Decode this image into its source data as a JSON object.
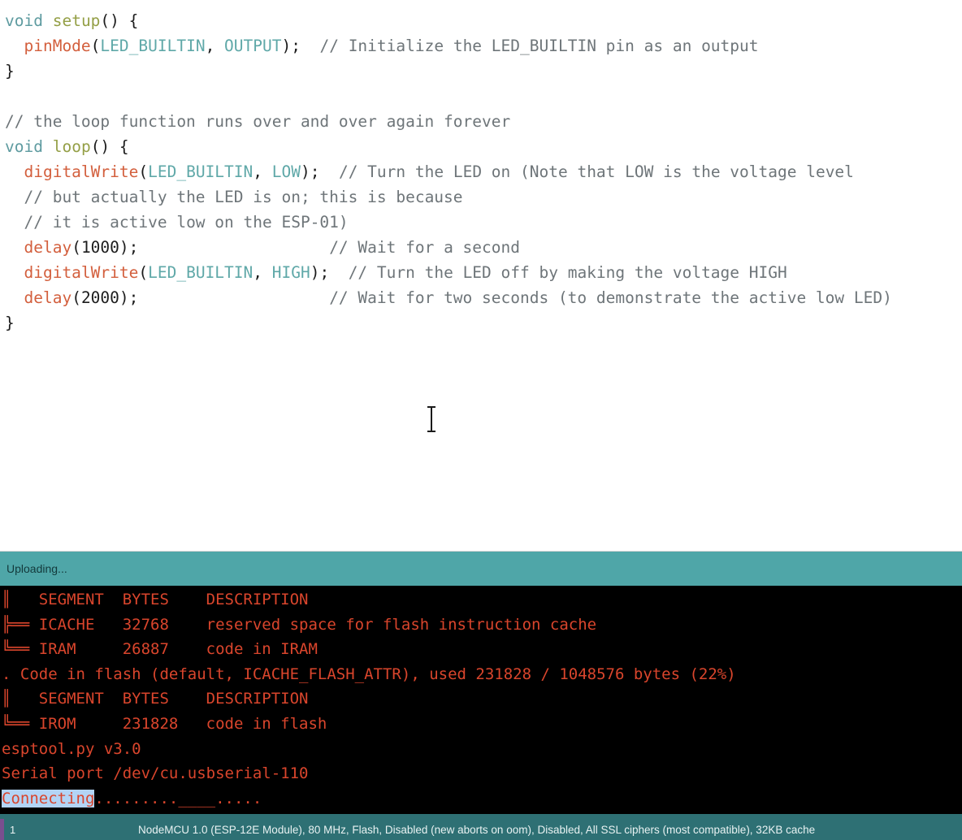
{
  "app": {
    "name": "Arduino IDE",
    "theme_colors": {
      "editor_background": "#ffffff",
      "console_background": "#000000",
      "console_text": "#d9452c",
      "upload_banner": "#4fa6a8",
      "status_bar": "#2e7074",
      "status_accent": "#7a4f8f",
      "selection_highlight": "#b3d4f5",
      "keyword": "#5e9ba0",
      "function_name": "#949f46",
      "builtin_function": "#d35f3d",
      "constant": "#5fa8a8",
      "comment": "#6e7579"
    }
  },
  "editor": {
    "lines": [
      {
        "tokens": [
          {
            "t": "void",
            "c": "kw"
          },
          {
            "t": " ",
            "c": "plain"
          },
          {
            "t": "setup",
            "c": "fnname"
          },
          {
            "t": "() {",
            "c": "plain"
          }
        ]
      },
      {
        "tokens": [
          {
            "t": "  ",
            "c": "plain"
          },
          {
            "t": "pinMode",
            "c": "func"
          },
          {
            "t": "(",
            "c": "plain"
          },
          {
            "t": "LED_BUILTIN",
            "c": "const"
          },
          {
            "t": ", ",
            "c": "plain"
          },
          {
            "t": "OUTPUT",
            "c": "const"
          },
          {
            "t": ");  ",
            "c": "plain"
          },
          {
            "t": "// Initialize the LED_BUILTIN pin as an output",
            "c": "comment"
          }
        ]
      },
      {
        "tokens": [
          {
            "t": "}",
            "c": "plain"
          }
        ]
      },
      {
        "tokens": [
          {
            "t": "",
            "c": "plain"
          }
        ]
      },
      {
        "tokens": [
          {
            "t": "// the loop function runs over and over again forever",
            "c": "comment"
          }
        ]
      },
      {
        "tokens": [
          {
            "t": "void",
            "c": "kw"
          },
          {
            "t": " ",
            "c": "plain"
          },
          {
            "t": "loop",
            "c": "fnname"
          },
          {
            "t": "() {",
            "c": "plain"
          }
        ]
      },
      {
        "tokens": [
          {
            "t": "  ",
            "c": "plain"
          },
          {
            "t": "digitalWrite",
            "c": "func"
          },
          {
            "t": "(",
            "c": "plain"
          },
          {
            "t": "LED_BUILTIN",
            "c": "const"
          },
          {
            "t": ", ",
            "c": "plain"
          },
          {
            "t": "LOW",
            "c": "const"
          },
          {
            "t": ");  ",
            "c": "plain"
          },
          {
            "t": "// Turn the LED on (Note that LOW is the voltage level",
            "c": "comment"
          }
        ]
      },
      {
        "tokens": [
          {
            "t": "  ",
            "c": "plain"
          },
          {
            "t": "// but actually the LED is on; this is because",
            "c": "comment"
          }
        ]
      },
      {
        "tokens": [
          {
            "t": "  ",
            "c": "plain"
          },
          {
            "t": "// it is active low on the ESP-01)",
            "c": "comment"
          }
        ]
      },
      {
        "tokens": [
          {
            "t": "  ",
            "c": "plain"
          },
          {
            "t": "delay",
            "c": "func"
          },
          {
            "t": "(",
            "c": "plain"
          },
          {
            "t": "1000",
            "c": "num"
          },
          {
            "t": ");                    ",
            "c": "plain"
          },
          {
            "t": "// Wait for a second",
            "c": "comment"
          }
        ]
      },
      {
        "tokens": [
          {
            "t": "  ",
            "c": "plain"
          },
          {
            "t": "digitalWrite",
            "c": "func"
          },
          {
            "t": "(",
            "c": "plain"
          },
          {
            "t": "LED_BUILTIN",
            "c": "const"
          },
          {
            "t": ", ",
            "c": "plain"
          },
          {
            "t": "HIGH",
            "c": "const"
          },
          {
            "t": ");  ",
            "c": "plain"
          },
          {
            "t": "// Turn the LED off by making the voltage HIGH",
            "c": "comment"
          }
        ]
      },
      {
        "tokens": [
          {
            "t": "  ",
            "c": "plain"
          },
          {
            "t": "delay",
            "c": "func"
          },
          {
            "t": "(",
            "c": "plain"
          },
          {
            "t": "2000",
            "c": "num"
          },
          {
            "t": ");                    ",
            "c": "plain"
          },
          {
            "t": "// Wait for two seconds (to demonstrate the active low LED)",
            "c": "comment"
          }
        ]
      },
      {
        "tokens": [
          {
            "t": "}",
            "c": "plain"
          }
        ]
      }
    ],
    "cursor_icon": "text-ibeam-cursor"
  },
  "upload_banner": {
    "label": "Uploading..."
  },
  "console": {
    "lines": [
      {
        "segments": [
          {
            "t": "║   SEGMENT  BYTES    DESCRIPTION",
            "sel": false
          }
        ]
      },
      {
        "segments": [
          {
            "t": "╠══ ICACHE   32768    reserved space for flash instruction cache",
            "sel": false
          }
        ]
      },
      {
        "segments": [
          {
            "t": "╚══ IRAM     26887    code in IRAM",
            "sel": false
          }
        ]
      },
      {
        "segments": [
          {
            "t": ". Code in flash (default, ICACHE_FLASH_ATTR), used 231828 / 1048576 bytes (22%)",
            "sel": false
          }
        ]
      },
      {
        "segments": [
          {
            "t": "║   SEGMENT  BYTES    DESCRIPTION",
            "sel": false
          }
        ]
      },
      {
        "segments": [
          {
            "t": "╚══ IROM     231828   code in flash",
            "sel": false
          }
        ]
      },
      {
        "segments": [
          {
            "t": "esptool.py v3.0",
            "sel": false
          }
        ]
      },
      {
        "segments": [
          {
            "t": "Serial port /dev/cu.usbserial-110",
            "sel": false
          }
        ]
      },
      {
        "segments": [
          {
            "t": "Connecting",
            "sel": true
          },
          {
            "t": ".........____.....",
            "sel": false
          }
        ]
      }
    ]
  },
  "status_bar": {
    "line_number": "1",
    "board_info": "NodeMCU 1.0 (ESP-12E Module), 80 MHz, Flash, Disabled (new aborts on oom), Disabled, All SSL ciphers (most compatible), 32KB cache"
  }
}
